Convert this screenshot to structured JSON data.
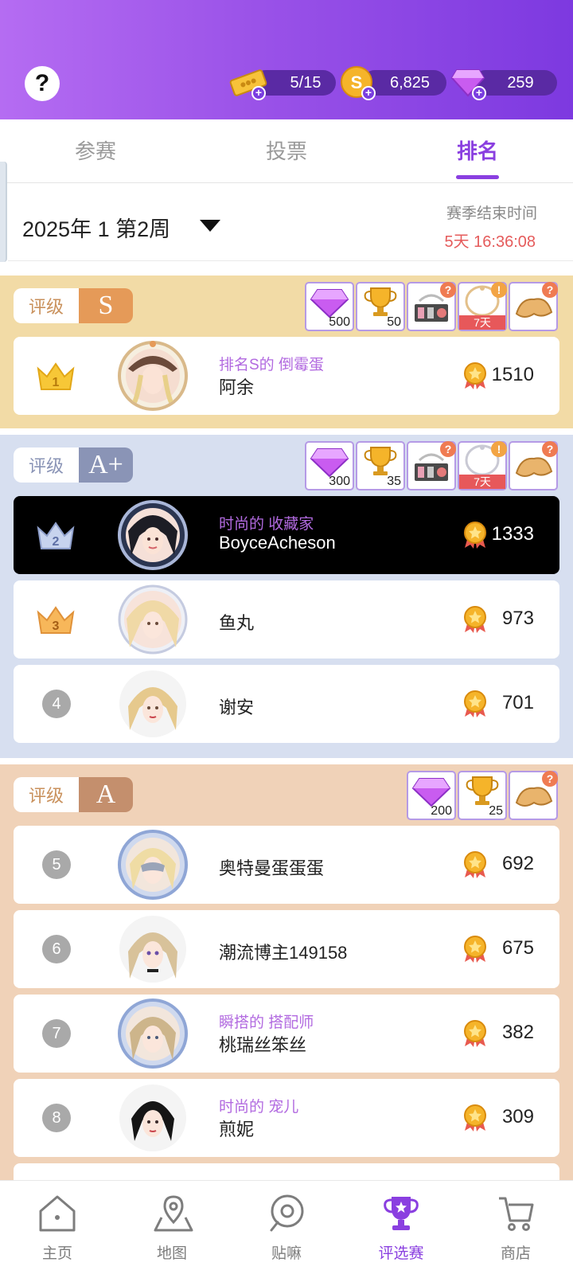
{
  "header": {
    "help_label": "?",
    "tickets": "5/15",
    "coins": "6,825",
    "gems": "259"
  },
  "tabs": [
    {
      "label": "参赛"
    },
    {
      "label": "投票"
    },
    {
      "label": "排名",
      "active": true
    }
  ],
  "week_selector": {
    "label": "2025年 1 第2周",
    "season_end_label": "赛季结束时间",
    "season_end_time": "5天 16:36:08"
  },
  "sections": {
    "s": {
      "grade_label": "评级",
      "grade": "S",
      "rewards": [
        {
          "icon": "gem-icon",
          "count": "500"
        },
        {
          "icon": "trophy-icon",
          "count": "50"
        },
        {
          "icon": "makeup-box-icon"
        },
        {
          "icon": "necklace-icon",
          "timer": "7天"
        },
        {
          "icon": "fortune-cookie-icon"
        }
      ]
    },
    "a_plus": {
      "grade_label": "评级",
      "grade": "A+",
      "rewards": [
        {
          "icon": "gem-icon",
          "count": "300"
        },
        {
          "icon": "trophy-icon",
          "count": "35"
        },
        {
          "icon": "makeup-box-icon"
        },
        {
          "icon": "necklace-icon",
          "timer": "7天"
        },
        {
          "icon": "fortune-cookie-icon"
        }
      ]
    },
    "a": {
      "grade_label": "评级",
      "grade": "A",
      "rewards": [
        {
          "icon": "gem-icon",
          "count": "200"
        },
        {
          "icon": "trophy-icon",
          "count": "25"
        },
        {
          "icon": "fortune-cookie-icon"
        }
      ]
    }
  },
  "rankings": [
    {
      "rank": "1",
      "title": "排名S的 倒霉蛋",
      "name": "阿余",
      "score": "1510"
    },
    {
      "rank": "2",
      "title": "时尚的 收藏家",
      "name": "BoyceAcheson",
      "score": "1333",
      "highlight": true
    },
    {
      "rank": "3",
      "title": "",
      "name": "鱼丸",
      "score": "973"
    },
    {
      "rank": "4",
      "title": "",
      "name": "谢安",
      "score": "701"
    },
    {
      "rank": "5",
      "title": "",
      "name": "奥特曼蛋蛋蛋",
      "score": "692"
    },
    {
      "rank": "6",
      "title": "",
      "name": "潮流博主149158",
      "score": "675"
    },
    {
      "rank": "7",
      "title": "瞬搭的 搭配师",
      "name": "桃瑞丝笨丝",
      "score": "382"
    },
    {
      "rank": "8",
      "title": "时尚的 宠儿",
      "name": "煎妮",
      "score": "309"
    }
  ],
  "bottom_nav": [
    {
      "label": "主页",
      "icon": "home-icon"
    },
    {
      "label": "地图",
      "icon": "map-pin-icon"
    },
    {
      "label": "贴嘛",
      "icon": "chat-icon"
    },
    {
      "label": "评选赛",
      "icon": "trophy-icon",
      "active": true
    },
    {
      "label": "商店",
      "icon": "cart-icon"
    }
  ],
  "colors": {
    "brand_purple": "#8a3fe0",
    "section_s": "#f2dba6",
    "section_a_plus": "#d7dff0",
    "section_a": "#f0d2b8",
    "timer_red": "#e55b5b"
  }
}
